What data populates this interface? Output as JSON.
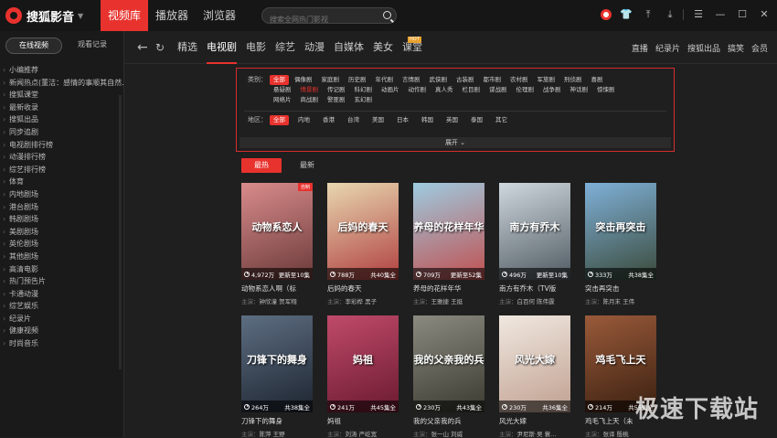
{
  "app": {
    "name": "搜狐影音"
  },
  "top_tabs": [
    "视频库",
    "播放器",
    "浏览器"
  ],
  "search": {
    "placeholder": "搜索全网热门影视"
  },
  "sidebar": {
    "tabs": [
      "在线视频",
      "观看记录"
    ],
    "items": [
      "小编推荐",
      "新闻热点(董洁：感情的事顺其自然...",
      "搜狐课堂",
      "最新收录",
      "搜狐出品",
      "同步追剧",
      "电视剧排行榜",
      "动漫排行榜",
      "综艺排行榜",
      "体育",
      "内地剧场",
      "港台剧场",
      "韩剧剧场",
      "美剧剧场",
      "英伦剧场",
      "其他剧场",
      "高清电影",
      "热门预告片",
      "卡通动漫",
      "综艺娱乐",
      "纪录片",
      "健康视频",
      "时尚音乐"
    ]
  },
  "nav": {
    "items": [
      "精选",
      "电视剧",
      "电影",
      "综艺",
      "动漫",
      "自媒体",
      "美女",
      "课堂"
    ],
    "badge": "HOT",
    "right": [
      "直播",
      "纪录片",
      "搜狐出品",
      "搞笑",
      "会员"
    ]
  },
  "filter": {
    "genre_label": "类别：",
    "genres": [
      "全部",
      "偶像剧",
      "家庭剧",
      "历史剧",
      "年代剧",
      "言情剧",
      "武侠剧",
      "古装剧",
      "都市剧",
      "农村剧",
      "军旅剧",
      "刑侦剧",
      "喜剧",
      "悬疑剧",
      "情景剧",
      "传记剧",
      "科幻剧",
      "动画片",
      "动作剧",
      "真人秀",
      "栏目剧",
      "谍战剧",
      "伦理剧",
      "战争剧",
      "神话剧",
      "惊悚剧",
      "网络片",
      "商战剧",
      "警匪剧",
      "玄幻剧"
    ],
    "region_label": "地区：",
    "regions": [
      "全部",
      "内地",
      "香港",
      "台湾",
      "美国",
      "日本",
      "韩国",
      "英国",
      "泰国",
      "其它"
    ],
    "expand": "展开"
  },
  "sort": [
    "最热",
    "最新"
  ],
  "actors_prefix": "主演：",
  "cards": [
    {
      "title": "动物系恋人啊（标",
      "actors": "钟欣潼 贺军翔",
      "views": "4,972万",
      "ep": "更新至10集",
      "poster_text": "动物系恋人",
      "color1": "#d98b8b",
      "color2": "#6b3a3a",
      "tag": "自制"
    },
    {
      "title": "后妈的春天",
      "actors": "李彩桦 黑子",
      "views": "788万",
      "ep": "共40集全",
      "poster_text": "后妈的春天",
      "color1": "#e8d7b0",
      "color2": "#b04040",
      "tag": ""
    },
    {
      "title": "养母的花样年华",
      "actors": "王雅捷 王挺",
      "views": "709万",
      "ep": "更新至52集",
      "poster_text": "养母的花样年华",
      "color1": "#9ecbe0",
      "color2": "#c05050",
      "tag": ""
    },
    {
      "title": "南方有乔木（TV版",
      "actors": "白百何 陈伟霆",
      "views": "496万",
      "ep": "更新至10集",
      "poster_text": "南方有乔木",
      "color1": "#cfd8de",
      "color2": "#505a62",
      "tag": ""
    },
    {
      "title": "突击再突击",
      "actors": "陈月末 王伟",
      "views": "333万",
      "ep": "共38集全",
      "poster_text": "突击再突击",
      "color1": "#7fb0d8",
      "color2": "#3a4a3a",
      "tag": ""
    },
    {
      "title": "刀锋下的舞身",
      "actors": "陈萍 王野",
      "views": "264万",
      "ep": "共38集全",
      "poster_text": "刀锋下的舞身",
      "color1": "#5d6e82",
      "color2": "#1d2430",
      "tag": ""
    },
    {
      "title": "妈祖",
      "actors": "刘涛 严屹宽",
      "views": "241万",
      "ep": "共45集全",
      "poster_text": "妈祖",
      "color1": "#c04a6a",
      "color2": "#6a1a30",
      "tag": ""
    },
    {
      "title": "我的父亲我的兵",
      "actors": "张一山 刘威",
      "views": "230万",
      "ep": "共43集全",
      "poster_text": "我的父亲我的兵",
      "color1": "#8a8a80",
      "color2": "#3a3a30",
      "tag": ""
    },
    {
      "title": "风光大嫁",
      "actors": "尹尼斯·吴 蓑...",
      "views": "230万",
      "ep": "共36集全",
      "poster_text": "风光大嫁",
      "color1": "#f0e8e0",
      "color2": "#c0a090",
      "tag": ""
    },
    {
      "title": "鸡毛飞上天（未",
      "actors": "张译 殷桃",
      "views": "214万",
      "ep": "共55集全",
      "poster_text": "鸡毛飞上天",
      "color1": "#9a5a3a",
      "color2": "#3a2010",
      "tag": ""
    }
  ],
  "watermark": "极速下载站"
}
